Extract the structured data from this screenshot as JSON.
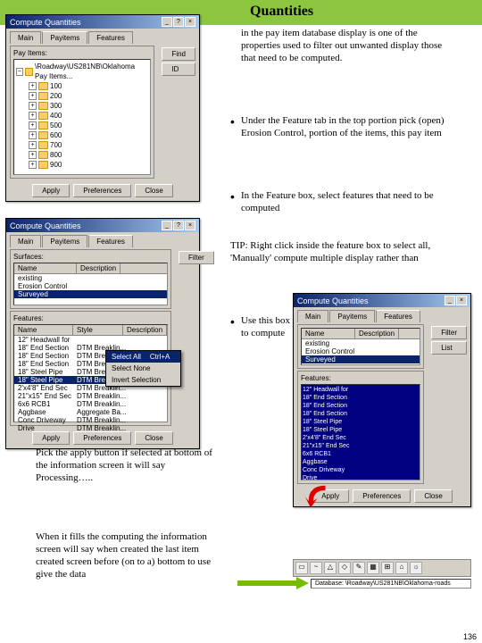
{
  "header": {
    "title": "Quantities"
  },
  "intro_text": "in the pay item database display is one of the properties used to filter out unwanted display those that need to be computed.",
  "bullet1": "Under the Feature tab in the top portion pick (open) Erosion Control, portion of the items, this pay item",
  "bullet2": "In the Feature box, select features that need to be computed",
  "tip_text": "TIP: Right click inside the feature box to select all, 'Manually' compute multiple display rather than",
  "bullet3": "Use this box to compute",
  "para1": "Pick the apply button if selected at bottom of the information screen it will say Processing…..",
  "para2": "When it fills the computing the information screen will say when created the last item created screen before (on to a) bottom to use give the data",
  "window1": {
    "title": "Compute Quantities",
    "tabs": [
      "Main",
      "Payitems",
      "Features"
    ],
    "panel_label": "Pay Items:",
    "root": "\\Roadway\\US281NB\\Oklahoma Pay Items...",
    "folders": [
      "100",
      "200",
      "300",
      "400",
      "500",
      "600",
      "700",
      "800",
      "900"
    ],
    "buttons": [
      "Apply",
      "Preferences",
      "Close"
    ],
    "side_buttons": [
      "Find",
      "ID"
    ]
  },
  "window2": {
    "title": "Compute Quantities",
    "tabs": [
      "Main",
      "Payitems",
      "Features"
    ],
    "panel1_label": "Surfaces:",
    "col_name": "Name",
    "col_desc": "Description",
    "col_style": "Style",
    "filter_btn": "Filter",
    "surfaces": [
      "Name",
      "existing",
      "Erosion Control",
      "Surveyed"
    ],
    "panel2_label": "Features:",
    "features": [
      {
        "n": "12\" Headwall for",
        "s": ""
      },
      {
        "n": "18\" End Section",
        "s": "DTM Breaklin..."
      },
      {
        "n": "18\" End Section",
        "s": "DTM Breaklin..."
      },
      {
        "n": "18\" End Section",
        "s": "DTM Breaklin..."
      },
      {
        "n": "18\" Steel Pipe",
        "s": "DTM Breaklin..."
      },
      {
        "n": "18\" Steel Pipe",
        "s": "DTM Breaklin..."
      },
      {
        "n": "2'x4'8\" End Sec",
        "s": "DTM Breaklin..."
      },
      {
        "n": "21\"x15\" End Sec",
        "s": "DTM Breaklin..."
      },
      {
        "n": "6x6 RCB1",
        "s": "DTM Breaklin..."
      },
      {
        "n": "Aggbase",
        "s": "Aggregate Ba..."
      },
      {
        "n": "Conc Driveway",
        "s": "DTM Breaklin..."
      },
      {
        "n": "Drive",
        "s": "DTM Breaklin..."
      }
    ],
    "context_menu": [
      {
        "label": "Select All",
        "shortcut": "Ctrl+A"
      },
      {
        "label": "Select None",
        "shortcut": ""
      },
      {
        "label": "Invert Selection",
        "shortcut": ""
      }
    ],
    "buttons": [
      "Apply",
      "Preferences",
      "Close"
    ]
  },
  "window3": {
    "title": "Compute Quantities",
    "surfaces": [
      "Name",
      "existing",
      "Erosion Control",
      "Surveyed"
    ],
    "features_sel": [
      "12\" Headwall for",
      "18\" End Section",
      "18\" End Section",
      "18\" End Section",
      "18\" Steel Pipe",
      "18\" Steel Pipe",
      "2'x4'8\" End Sec",
      "21\"x15\" End Sec",
      "6x6 RCB1",
      "Aggbase",
      "Conc Driveway",
      "Drive"
    ],
    "buttons": [
      "Apply",
      "Preferences",
      "Close"
    ],
    "side_buttons": [
      "Filter",
      "List"
    ]
  },
  "db_status": "Database: \\Roadway\\US281NB\\Oklahoma-roads",
  "page": "136"
}
